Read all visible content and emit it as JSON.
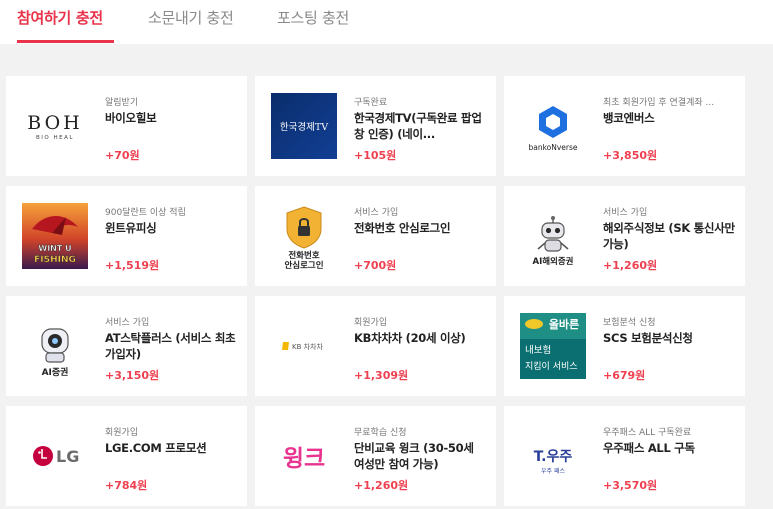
{
  "tabs": [
    {
      "label": "참여하기 충전",
      "active": true
    },
    {
      "label": "소문내기 충전",
      "active": false
    },
    {
      "label": "포스팅 충전",
      "active": false
    }
  ],
  "offers": [
    {
      "category": "알림받기",
      "title": "바이오힐보",
      "reward": "+70원",
      "logo": {
        "text": "BOH",
        "subtext": "BIO HEAL"
      }
    },
    {
      "category": "구독완료",
      "title": "한국경제TV(구독완료 팝업 창 인증) (네이...",
      "reward": "+105원",
      "logo": {
        "text": "한국경제TV"
      }
    },
    {
      "category": "최초 회원가입 후 연결계좌 ...",
      "title": "뱅코엔버스",
      "reward": "+3,850원",
      "logo": {
        "text": "bankoNverse"
      }
    },
    {
      "category": "900달란트 이상 적립",
      "title": "윈트유피싱",
      "reward": "+1,519원",
      "logo": {
        "text": "WINT U",
        "subtext": "FISHING"
      }
    },
    {
      "category": "서비스 가입",
      "title": "전화번호 안심로그인",
      "reward": "+700원",
      "logo": {
        "text": "전화번호",
        "subtext": "안심로그인"
      }
    },
    {
      "category": "서비스 가입",
      "title": "해외주식정보 (SK 통신사만 가능)",
      "reward": "+1,260원",
      "logo": {
        "text": "AI해외증권"
      }
    },
    {
      "category": "서비스 가입",
      "title": "AT스탁플러스 (서비스 최초 가입자)",
      "reward": "+3,150원",
      "logo": {
        "text": "AI증권"
      }
    },
    {
      "category": "회원가입",
      "title": "KB차차차 (20세 이상)",
      "reward": "+1,309원",
      "logo": {
        "text": "KB 차차차"
      }
    },
    {
      "category": "보험분석 신청",
      "title": "SCS 보험분석신청",
      "reward": "+679원",
      "logo": {
        "text": "올바른",
        "subtext": "내보험",
        "subtext2": "지킴이 서비스"
      }
    },
    {
      "category": "회원가입",
      "title": "LGE.COM 프로모션",
      "reward": "+784원",
      "logo": {
        "text": "LG"
      }
    },
    {
      "category": "무료학습 신청",
      "title": "단비교육 윙크 (30-50세 여성만 참여 가능)",
      "reward": "+1,260원",
      "logo": {
        "text": "윙크"
      }
    },
    {
      "category": "우주패스 ALL 구독완료",
      "title": "우주패스 ALL 구독",
      "reward": "+3,570원",
      "logo": {
        "text": "T.우주",
        "subtext": "우주 패스"
      }
    }
  ],
  "colors": {
    "accent": "#e8334a",
    "reward": "#ef4050",
    "background": "#f2f2f2"
  }
}
